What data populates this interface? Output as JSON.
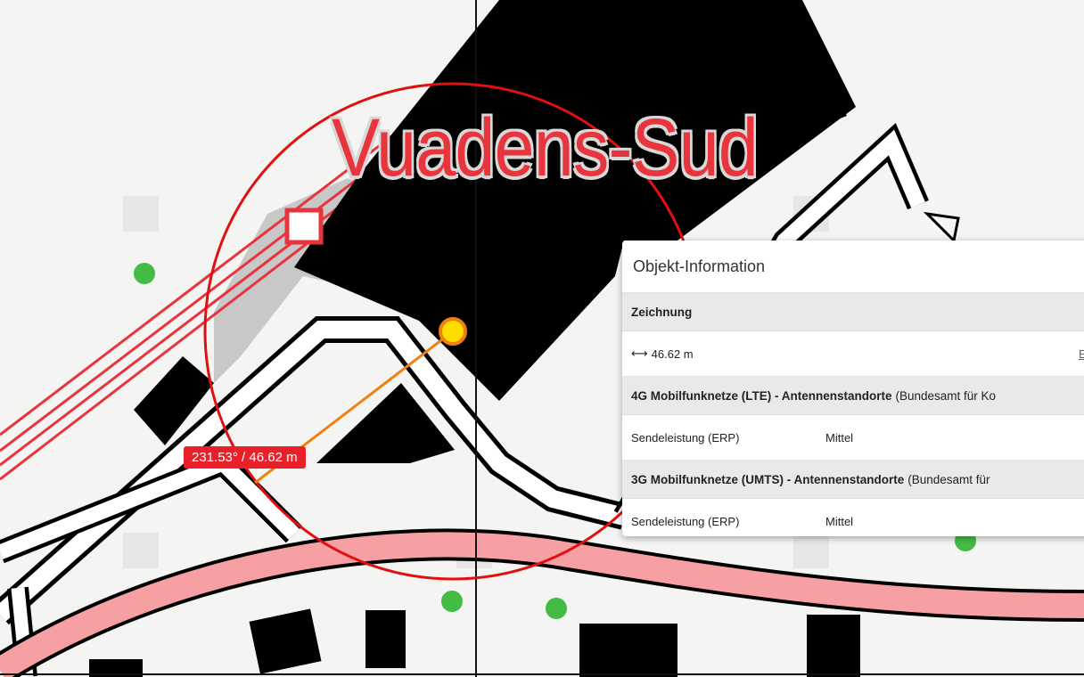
{
  "map": {
    "place_label": "Vuadens-Sud",
    "measure": {
      "angle_distance": "231.53° / 46.62 m"
    },
    "colors": {
      "railway": "#e8343c",
      "road_fill": "#f6a0a4",
      "circle": "#e01010",
      "measure_line": "#f08010",
      "marker_fill": "#ffdd00",
      "poi": "#44bb44"
    }
  },
  "info_panel": {
    "title": "Objekt-Information",
    "sections": [
      {
        "heading": "Zeichnung",
        "rows": [
          {
            "icon": "distance-icon",
            "value": "46.62 m",
            "link": "E"
          }
        ]
      },
      {
        "heading": "4G Mobilfunknetze (LTE) - Antennenstandorte",
        "source": "(Bundesamt für Ko",
        "rows": [
          {
            "key": "Sendeleistung (ERP)",
            "value": "Mittel"
          }
        ]
      },
      {
        "heading": "3G Mobilfunknetze (UMTS) - Antennenstandorte",
        "source": "(Bundesamt für",
        "rows": [
          {
            "key": "Sendeleistung (ERP)",
            "value": "Mittel"
          }
        ]
      }
    ]
  }
}
